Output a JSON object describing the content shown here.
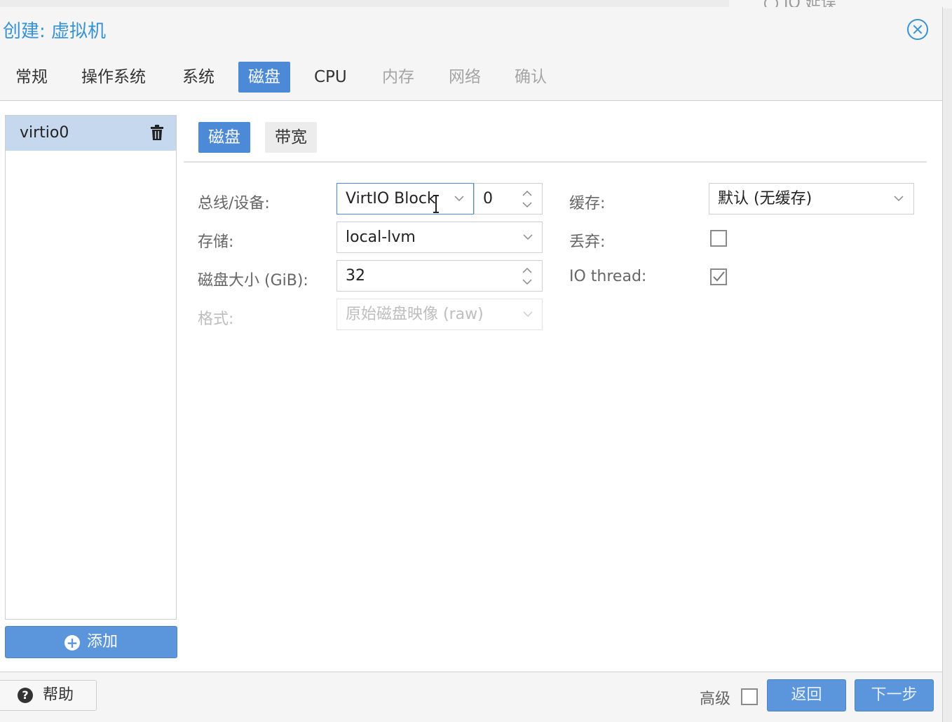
{
  "background": {
    "fragment_text": "IO 延误"
  },
  "window": {
    "title": "创建: 虚拟机"
  },
  "tabs": [
    {
      "label": "常规",
      "state": "normal"
    },
    {
      "label": "操作系统",
      "state": "normal"
    },
    {
      "label": "系统",
      "state": "normal"
    },
    {
      "label": "磁盘",
      "state": "active"
    },
    {
      "label": "CPU",
      "state": "normal"
    },
    {
      "label": "内存",
      "state": "disabled"
    },
    {
      "label": "网络",
      "state": "disabled"
    },
    {
      "label": "确认",
      "state": "disabled"
    }
  ],
  "disk_list": {
    "items": [
      {
        "label": "virtio0"
      }
    ],
    "add_label": "添加"
  },
  "subtabs": {
    "disk": "磁盘",
    "bandwidth": "带宽"
  },
  "form": {
    "bus_label": "总线/设备:",
    "bus_value": "VirtIO Block",
    "device_index": "0",
    "storage_label": "存储:",
    "storage_value": "local-lvm",
    "size_label": "磁盘大小 (GiB):",
    "size_value": "32",
    "format_label": "格式:",
    "format_value": "原始磁盘映像 (raw)",
    "cache_label": "缓存:",
    "cache_value": "默认 (无缓存)",
    "discard_label": "丢弃:",
    "discard_checked": false,
    "iothread_label": "IO thread:",
    "iothread_checked": true
  },
  "footer": {
    "help_label": "帮助",
    "advanced_label": "高级",
    "advanced_checked": false,
    "back_label": "返回",
    "next_label": "下一步"
  },
  "colors": {
    "accent": "#4c89d6",
    "button": "#5b95dc",
    "selected_row": "#c5d8ee",
    "title": "#3892d4"
  }
}
